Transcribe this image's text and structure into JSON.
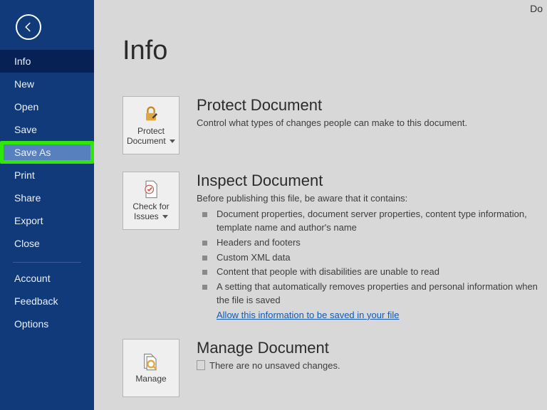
{
  "topright": "Do",
  "sidebar": {
    "items": [
      {
        "label": "Info",
        "active": true
      },
      {
        "label": "New"
      },
      {
        "label": "Open"
      },
      {
        "label": "Save"
      },
      {
        "label": "Save As",
        "highlight": true
      },
      {
        "label": "Print"
      },
      {
        "label": "Share"
      },
      {
        "label": "Export"
      },
      {
        "label": "Close"
      }
    ],
    "footer": [
      {
        "label": "Account"
      },
      {
        "label": "Feedback"
      },
      {
        "label": "Options"
      }
    ]
  },
  "page": {
    "title": "Info"
  },
  "protect": {
    "button": "Protect Document",
    "title": "Protect Document",
    "desc": "Control what types of changes people can make to this document."
  },
  "inspect": {
    "button": "Check for Issues",
    "title": "Inspect Document",
    "desc": "Before publishing this file, be aware that it contains:",
    "items": [
      "Document properties, document server properties, content type information, template name and author's name",
      "Headers and footers",
      "Custom XML data",
      "Content that people with disabilities are unable to read",
      "A setting that automatically removes properties and personal information when the file is saved"
    ],
    "link": "Allow this information to be saved in your file"
  },
  "manage": {
    "button": "Manage",
    "title": "Manage Document",
    "desc": "There are no unsaved changes."
  }
}
